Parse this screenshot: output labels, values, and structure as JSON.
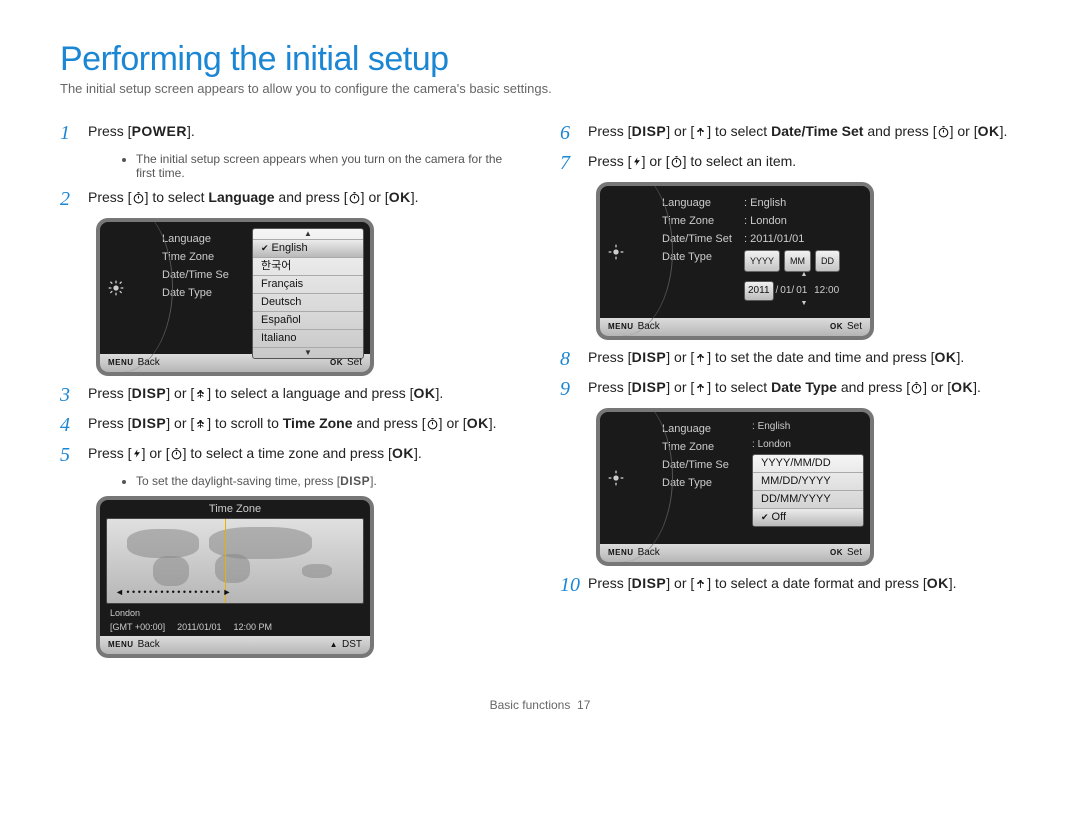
{
  "title": "Performing the initial setup",
  "subtitle": "The initial setup screen appears to allow you to configure the camera's basic settings.",
  "steps_left": {
    "s1": {
      "num": "1",
      "parts": [
        "Press [",
        "POWER",
        "]."
      ]
    },
    "s1_note": "The initial setup screen appears when you turn on the camera for the first time.",
    "s2": {
      "num": "2",
      "parts": [
        "Press [",
        "] to select ",
        "Language",
        " and press [",
        "] or [",
        "OK",
        "]."
      ]
    },
    "s3": {
      "num": "3",
      "parts": [
        "Press [",
        "DISP",
        "] or [",
        "] to select a language and press [",
        "OK",
        "]."
      ]
    },
    "s4": {
      "num": "4",
      "parts": [
        "Press [",
        "DISP",
        "] or [",
        "] to scroll to ",
        "Time Zone",
        " and press [",
        "] or [",
        "OK",
        "]."
      ]
    },
    "s5": {
      "num": "5",
      "parts": [
        "Press [",
        "] or [",
        "] to select a time zone and press [",
        "OK",
        "]."
      ]
    },
    "s5_note": [
      "To set the daylight-saving time, press [",
      "DISP",
      "]."
    ]
  },
  "steps_right": {
    "s6": {
      "num": "6",
      "parts": [
        "Press [",
        "DISP",
        "] or [",
        "] to select ",
        "Date/Time Set",
        " and press [",
        "] or [",
        "OK",
        "]."
      ]
    },
    "s7": {
      "num": "7",
      "parts": [
        "Press [",
        "] or [",
        "] to select an item."
      ]
    },
    "s8": {
      "num": "8",
      "parts": [
        "Press [",
        "DISP",
        "] or [",
        "] to set the date and time and press [",
        "OK",
        "]."
      ]
    },
    "s9": {
      "num": "9",
      "parts": [
        "Press [",
        "DISP",
        "] or [",
        "] to select ",
        "Date Type",
        " and press [",
        "] or [",
        "OK",
        "]."
      ]
    },
    "s10": {
      "num": "10",
      "parts": [
        "Press [",
        "DISP",
        "] or [",
        "] to select a date format and press [",
        "OK",
        "]."
      ]
    }
  },
  "lcd_lang": {
    "items": [
      "Language",
      "Time Zone",
      "Date/Time Se",
      "Date Type"
    ],
    "options": [
      "English",
      "한국어",
      "Français",
      "Deutsch",
      "Español",
      "Italiano"
    ],
    "selected": "English",
    "foot": {
      "left_tag": "MENU",
      "left": "Back",
      "right_tag": "OK",
      "right": "Set"
    }
  },
  "lcd_tz": {
    "title": "Time Zone",
    "city": "London",
    "gmt": "[GMT +00:00]",
    "date": "2011/01/01",
    "time": "12:00 PM",
    "foot": {
      "left_tag": "MENU",
      "left": "Back",
      "right_tag": "▲",
      "right": "DST"
    }
  },
  "lcd_dt": {
    "rows": [
      {
        "label": "Language",
        "value": "English"
      },
      {
        "label": "Time Zone",
        "value": "London"
      },
      {
        "label": "Date/Time Set",
        "value": "2011/01/01"
      },
      {
        "label": "Date Type",
        "value": ""
      }
    ],
    "date_hdr": [
      "YYYY",
      "MM",
      "DD"
    ],
    "date_vals": [
      "2011",
      "/",
      "01/",
      "01",
      "12:00"
    ],
    "foot": {
      "left_tag": "MENU",
      "left": "Back",
      "right_tag": "OK",
      "right": "Set"
    }
  },
  "lcd_type": {
    "rows": [
      {
        "label": "Language",
        "value": "English"
      },
      {
        "label": "Time Zone",
        "value": "London"
      },
      {
        "label": "Date/Time Se",
        "value": ""
      },
      {
        "label": "Date Type",
        "value": ""
      }
    ],
    "options": [
      "YYYY/MM/DD",
      "MM/DD/YYYY",
      "DD/MM/YYYY",
      "Off"
    ],
    "selected": "Off",
    "foot": {
      "left_tag": "MENU",
      "left": "Back",
      "right_tag": "OK",
      "right": "Set"
    }
  },
  "footer": {
    "section": "Basic functions",
    "page": "17"
  }
}
